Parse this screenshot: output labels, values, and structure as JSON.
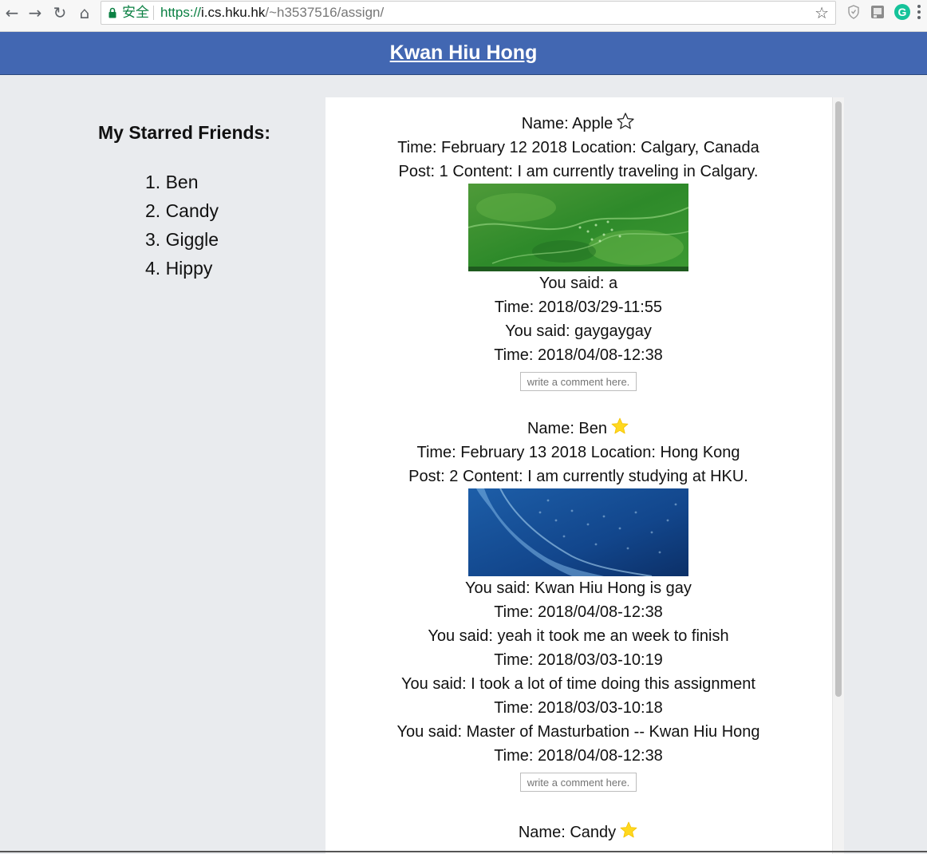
{
  "browser": {
    "secure_label": "安全",
    "url_proto": "https://",
    "url_host": "i.cs.hku.hk",
    "url_path": "/~h3537516/assign/",
    "extensions": [
      "shield-extension",
      "notes-extension",
      "grammarly-extension"
    ],
    "extension_g_label": "G"
  },
  "header": {
    "title": "Kwan Hiu Hong",
    "color": "#4267b2"
  },
  "sidebar": {
    "heading": "My Starred Friends:",
    "friends": [
      "1. Ben",
      "2. Candy",
      "3. Giggle",
      "4. Hippy"
    ]
  },
  "posts": [
    {
      "name_line": "Name: Apple",
      "starred": false,
      "time_location": "Time: February 12 2018 Location: Calgary, Canada",
      "content": "Post: 1 Content: I am currently traveling in Calgary.",
      "image": "green aerial landscape",
      "comments": [
        {
          "text": "You said: a",
          "time": "Time: 2018/03/29-11:55"
        },
        {
          "text": "You said: gaygaygay",
          "time": "Time: 2018/04/08-12:38"
        }
      ],
      "comment_placeholder": "write a comment here."
    },
    {
      "name_line": "Name: Ben",
      "starred": true,
      "time_location": "Time: February 13 2018 Location: Hong Kong",
      "content": "Post: 2 Content: I am currently studying at HKU.",
      "image": "blue ocean aerial",
      "comments": [
        {
          "text": "You said: Kwan Hiu Hong is gay",
          "time": "Time: 2018/04/08-12:38"
        },
        {
          "text": "You said: yeah it took me an week to finish",
          "time": "Time: 2018/03/03-10:19"
        },
        {
          "text": "You said: I took a lot of time doing this assignment",
          "time": "Time: 2018/03/03-10:18"
        },
        {
          "text": "You said: Master of Masturbation -- Kwan Hiu Hong",
          "time": "Time: 2018/04/08-12:38"
        }
      ],
      "comment_placeholder": "write a comment here."
    },
    {
      "name_line": "Name: Candy",
      "starred": true
    }
  ]
}
